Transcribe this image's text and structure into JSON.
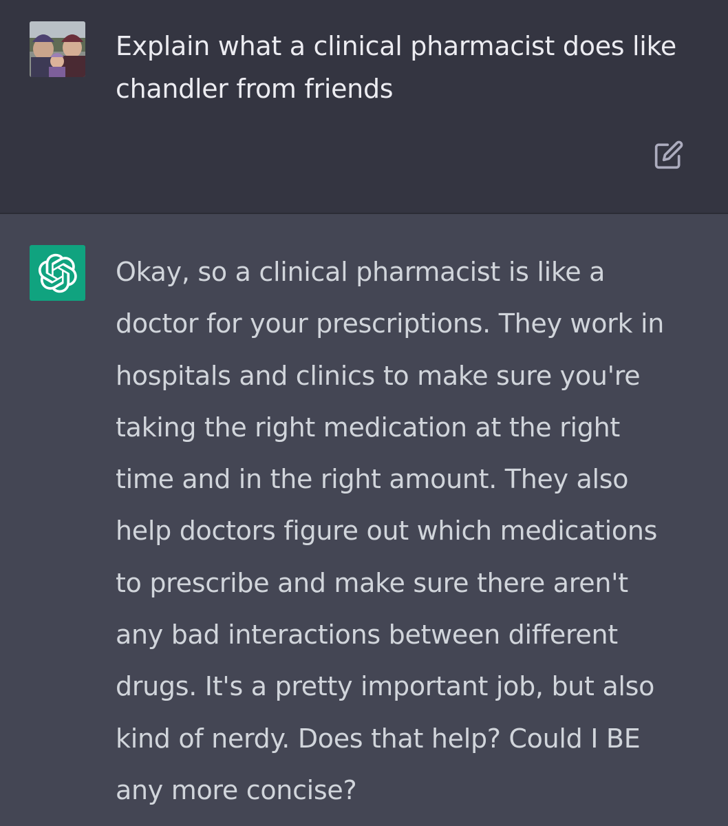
{
  "user_message": {
    "avatar_icon": "family-photo-avatar",
    "text_lines": [
      "Explain what a clinical pharmacist does like",
      "chandler from friends"
    ],
    "edit_icon": "edit-pencil-icon"
  },
  "assistant_message": {
    "avatar_icon": "openai-logo-icon",
    "avatar_color": "#10a37f",
    "text_lines": [
      "Okay, so a clinical pharmacist is like a",
      "doctor for your prescriptions. They work in",
      "hospitals and clinics to make sure you're",
      "taking the right medication at the right",
      "time and in the right amount. They also",
      "help doctors figure out which medications",
      "to prescribe and make sure there aren't",
      "any bad interactions between different",
      "drugs. It's a pretty important job, but also",
      "kind of nerdy. Does that help? Could I BE",
      "any more concise?"
    ]
  }
}
